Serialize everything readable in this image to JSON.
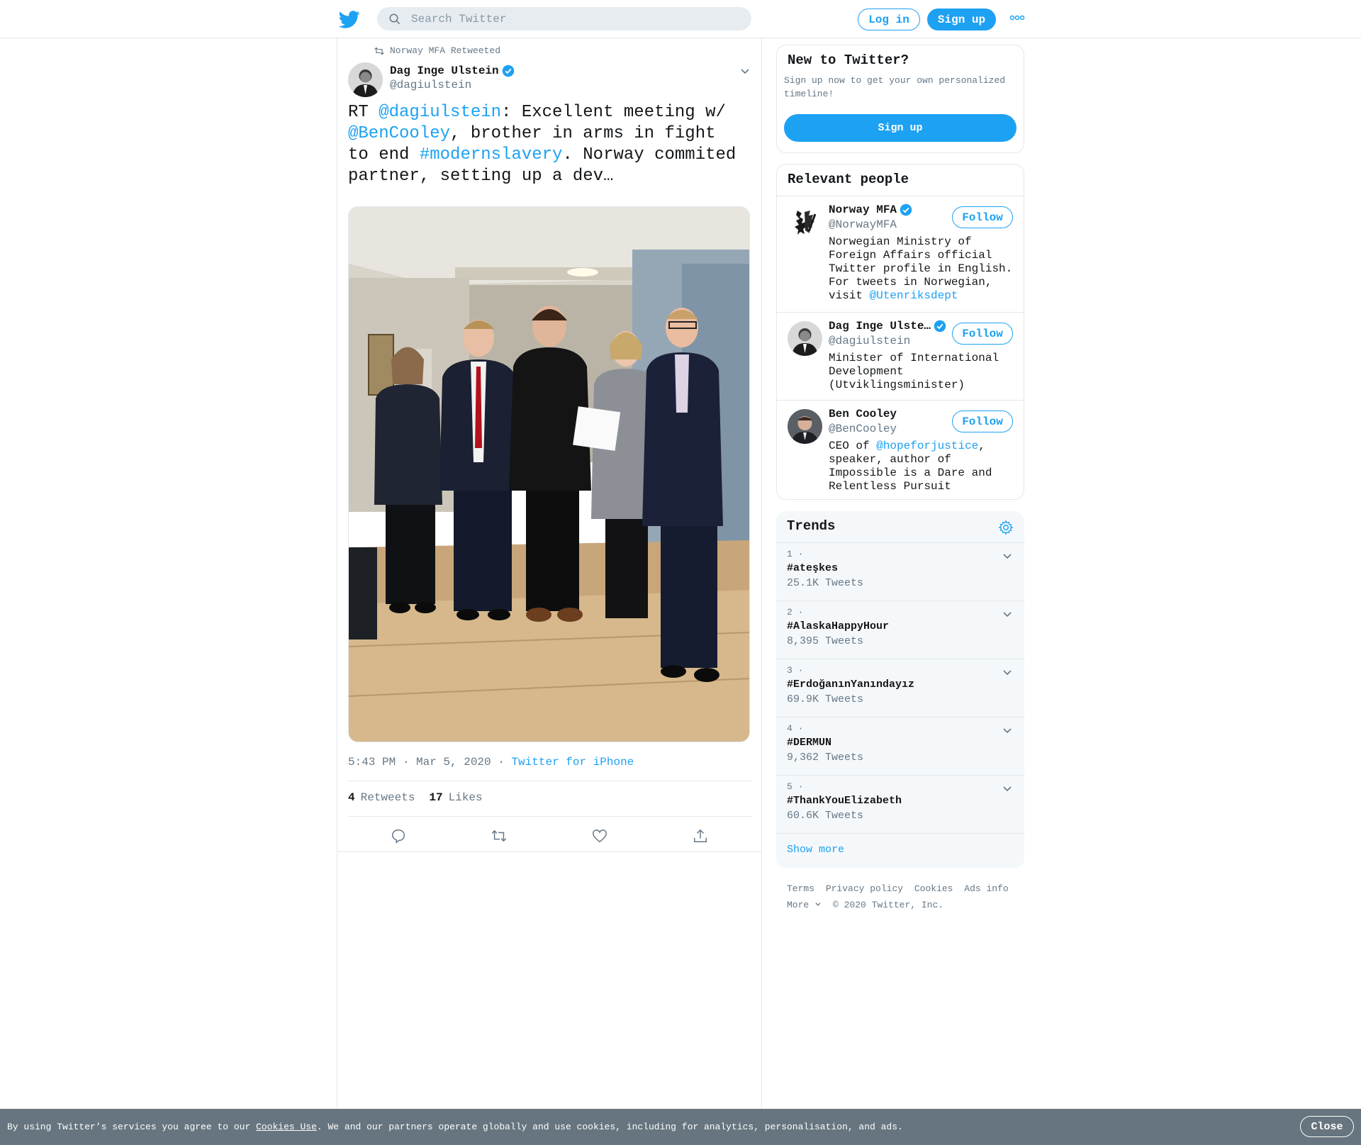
{
  "header": {
    "search_placeholder": "Search Twitter",
    "login_label": "Log in",
    "signup_label": "Sign up"
  },
  "tweet": {
    "retweeted_by": "Norway MFA Retweeted",
    "author_name": "Dag Inge Ulstein",
    "author_handle": "@dagiulstein",
    "text_parts": [
      {
        "t": "RT ",
        "link": false
      },
      {
        "t": "@dagiulstein",
        "link": true
      },
      {
        "t": ": Excellent meeting w/ ",
        "link": false
      },
      {
        "t": "@BenCooley",
        "link": true
      },
      {
        "t": ", brother in arms in fight to end ",
        "link": false
      },
      {
        "t": "#modernslavery",
        "link": true
      },
      {
        "t": ". Norway commited partner, setting up a dev…",
        "link": false
      }
    ],
    "time": "5:43 PM · Mar 5, 2020 ·",
    "source": "Twitter for iPhone",
    "retweets_count": "4",
    "retweets_label": "Retweets",
    "likes_count": "17",
    "likes_label": "Likes"
  },
  "new_to_twitter": {
    "title": "New to Twitter?",
    "subtitle": "Sign up now to get your own personalized timeline!",
    "button": "Sign up"
  },
  "relevant_people": {
    "title": "Relevant people",
    "follow_label": "Follow",
    "people": [
      {
        "name": "Norway MFA",
        "handle": "@NorwayMFA",
        "bio_text": "Norwegian Ministry of Foreign Affairs official Twitter profile in English. For tweets in Norwegian, visit ",
        "bio_link": "@Utenriksdept",
        "bio_after": ""
      },
      {
        "name": "Dag Inge Ulste…",
        "handle": "@dagiulstein",
        "bio_text": "Minister of International Development (Utviklingsminister)",
        "bio_link": "",
        "bio_after": ""
      },
      {
        "name": "Ben Cooley",
        "handle": "@BenCooley",
        "bio_text": "CEO of ",
        "bio_link": "@hopeforjustice",
        "bio_after": ", speaker, author of Impossible is a Dare and Relentless Pursuit"
      }
    ]
  },
  "trends": {
    "title": "Trends",
    "items": [
      {
        "rank": "1 ·",
        "name": "#ateşkes",
        "count": "25.1K Tweets"
      },
      {
        "rank": "2 ·",
        "name": "#AlaskaHappyHour",
        "count": "8,395 Tweets"
      },
      {
        "rank": "3 ·",
        "name": "#ErdoğanınYanındayız",
        "count": "69.9K Tweets"
      },
      {
        "rank": "4 ·",
        "name": "#DERMUN",
        "count": "9,362 Tweets"
      },
      {
        "rank": "5 ·",
        "name": "#ThankYouElizabeth",
        "count": "60.6K Tweets"
      }
    ],
    "show_more": "Show more"
  },
  "footer": {
    "links": [
      "Terms",
      "Privacy policy",
      "Cookies",
      "Ads info"
    ],
    "more": "More",
    "copyright": "© 2020 Twitter, Inc."
  },
  "cookie_bar": {
    "text_before": "By using Twitter’s services you agree to our ",
    "link": "Cookies Use",
    "text_after": ". We and our partners operate globally and use cookies, including for analytics, personalisation, and ads.",
    "close": "Close"
  },
  "colors": {
    "accent": "#1da1f2",
    "muted": "#657786",
    "border": "#e1e8ed",
    "cookie_bg": "#66757f"
  }
}
